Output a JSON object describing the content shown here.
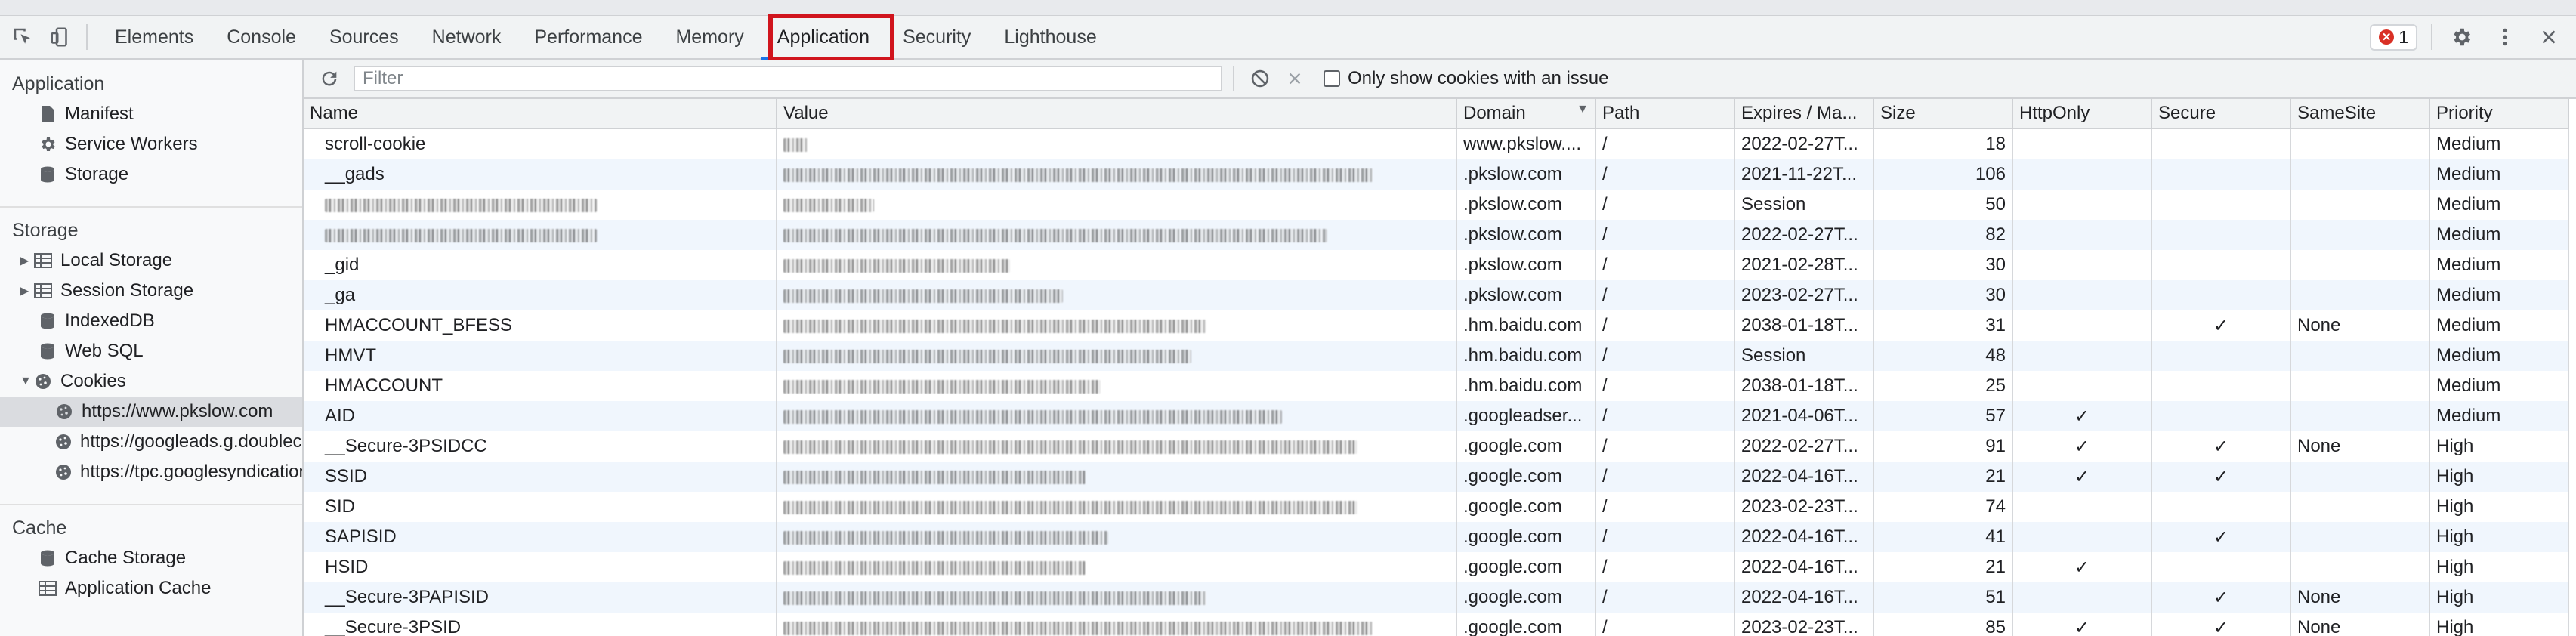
{
  "toolbar": {
    "tabs": [
      "Elements",
      "Console",
      "Sources",
      "Network",
      "Performance",
      "Memory",
      "Application",
      "Security",
      "Lighthouse"
    ],
    "active_tab": "Application",
    "error_count": "1"
  },
  "sidebar": {
    "application_header": "Application",
    "application_items": [
      "Manifest",
      "Service Workers",
      "Storage"
    ],
    "storage_header": "Storage",
    "storage_items": [
      "Local Storage",
      "Session Storage",
      "IndexedDB",
      "Web SQL",
      "Cookies"
    ],
    "cookie_origins": [
      "https://www.pkslow.com",
      "https://googleads.g.doubleclick.net",
      "https://tpc.googlesyndication.com"
    ],
    "cache_header": "Cache",
    "cache_items": [
      "Cache Storage",
      "Application Cache"
    ]
  },
  "filterbar": {
    "filter_placeholder": "Filter",
    "only_issues_label": "Only show cookies with an issue"
  },
  "table": {
    "headers": [
      "Name",
      "Value",
      "Domain",
      "Path",
      "Expires / Ma...",
      "Size",
      "HttpOnly",
      "Secure",
      "SameSite",
      "Priority"
    ],
    "rows": [
      {
        "name": "scroll-cookie",
        "domain": "www.pkslow....",
        "path": "/",
        "expires": "2022-02-27T...",
        "size": "18",
        "httponly": "",
        "secure": "",
        "samesite": "",
        "priority": "Medium"
      },
      {
        "name": "__gads",
        "domain": ".pkslow.com",
        "path": "/",
        "expires": "2021-11-22T...",
        "size": "106",
        "httponly": "",
        "secure": "",
        "samesite": "",
        "priority": "Medium"
      },
      {
        "name": "",
        "domain": ".pkslow.com",
        "path": "/",
        "expires": "Session",
        "size": "50",
        "httponly": "",
        "secure": "",
        "samesite": "",
        "priority": "Medium"
      },
      {
        "name": "",
        "domain": ".pkslow.com",
        "path": "/",
        "expires": "2022-02-27T...",
        "size": "82",
        "httponly": "",
        "secure": "",
        "samesite": "",
        "priority": "Medium"
      },
      {
        "name": "_gid",
        "domain": ".pkslow.com",
        "path": "/",
        "expires": "2021-02-28T...",
        "size": "30",
        "httponly": "",
        "secure": "",
        "samesite": "",
        "priority": "Medium"
      },
      {
        "name": "_ga",
        "domain": ".pkslow.com",
        "path": "/",
        "expires": "2023-02-27T...",
        "size": "30",
        "httponly": "",
        "secure": "",
        "samesite": "",
        "priority": "Medium"
      },
      {
        "name": "HMACCOUNT_BFESS",
        "domain": ".hm.baidu.com",
        "path": "/",
        "expires": "2038-01-18T...",
        "size": "31",
        "httponly": "",
        "secure": "✓",
        "samesite": "None",
        "priority": "Medium"
      },
      {
        "name": "HMVT",
        "domain": ".hm.baidu.com",
        "path": "/",
        "expires": "Session",
        "size": "48",
        "httponly": "",
        "secure": "",
        "samesite": "",
        "priority": "Medium"
      },
      {
        "name": "HMACCOUNT",
        "domain": ".hm.baidu.com",
        "path": "/",
        "expires": "2038-01-18T...",
        "size": "25",
        "httponly": "",
        "secure": "",
        "samesite": "",
        "priority": "Medium"
      },
      {
        "name": "AID",
        "domain": ".googleadser...",
        "path": "/",
        "expires": "2021-04-06T...",
        "size": "57",
        "httponly": "✓",
        "secure": "",
        "samesite": "",
        "priority": "Medium"
      },
      {
        "name": "__Secure-3PSIDCC",
        "domain": ".google.com",
        "path": "/",
        "expires": "2022-02-27T...",
        "size": "91",
        "httponly": "✓",
        "secure": "✓",
        "samesite": "None",
        "priority": "High"
      },
      {
        "name": "SSID",
        "domain": ".google.com",
        "path": "/",
        "expires": "2022-04-16T...",
        "size": "21",
        "httponly": "✓",
        "secure": "✓",
        "samesite": "",
        "priority": "High"
      },
      {
        "name": "SID",
        "domain": ".google.com",
        "path": "/",
        "expires": "2023-02-23T...",
        "size": "74",
        "httponly": "",
        "secure": "",
        "samesite": "",
        "priority": "High"
      },
      {
        "name": "SAPISID",
        "domain": ".google.com",
        "path": "/",
        "expires": "2022-04-16T...",
        "size": "41",
        "httponly": "",
        "secure": "✓",
        "samesite": "",
        "priority": "High"
      },
      {
        "name": "HSID",
        "domain": ".google.com",
        "path": "/",
        "expires": "2022-04-16T...",
        "size": "21",
        "httponly": "✓",
        "secure": "",
        "samesite": "",
        "priority": "High"
      },
      {
        "name": "__Secure-3PAPISID",
        "domain": ".google.com",
        "path": "/",
        "expires": "2022-04-16T...",
        "size": "51",
        "httponly": "",
        "secure": "✓",
        "samesite": "None",
        "priority": "High"
      },
      {
        "name": "__Secure-3PSID",
        "domain": ".google.com",
        "path": "/",
        "expires": "2023-02-23T...",
        "size": "85",
        "httponly": "✓",
        "secure": "✓",
        "samesite": "None",
        "priority": "High"
      }
    ]
  },
  "colors": {
    "highlight_border": "#d0141d",
    "accent": "#1a73e8",
    "alt_row": "#f0f6fd"
  }
}
